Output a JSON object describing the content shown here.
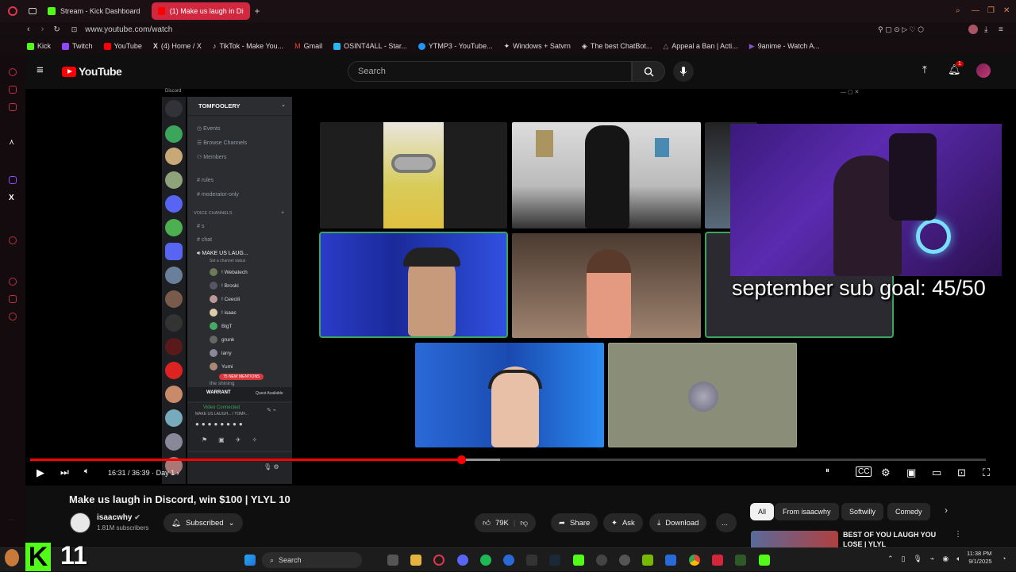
{
  "browser": {
    "tabs": [
      {
        "label": "Stream - Kick Dashboard",
        "color": "#53fc18"
      },
      {
        "label": "(1) Make us laugh in Disc",
        "color": "#ff0000"
      }
    ],
    "new_tab": "+",
    "url": "www.youtube.com/watch",
    "bookmarks": [
      {
        "label": "Kick",
        "color": "#53fc18"
      },
      {
        "label": "Twitch",
        "color": "#9146ff"
      },
      {
        "label": "YouTube",
        "color": "#ff0000"
      },
      {
        "label": "(4) Home / X",
        "color": "#ffffff"
      },
      {
        "label": "TikTok - Make You...",
        "color": "#ffffff"
      },
      {
        "label": "Gmail",
        "color": "#ea4335"
      },
      {
        "label": "OSINT4ALL - Star...",
        "color": "#29b6f6"
      },
      {
        "label": "YTMP3 - YouTube...",
        "color": "#2196f3"
      },
      {
        "label": "Windows + Satvrn",
        "color": "#ffffff"
      },
      {
        "label": "The best ChatBot...",
        "color": "#ffffff"
      },
      {
        "label": "Appeal a Ban | Acti...",
        "color": "#888888"
      },
      {
        "label": "9anime - Watch A...",
        "color": "#7e57c2"
      }
    ]
  },
  "youtube": {
    "logo": "YouTube",
    "search_placeholder": "Search",
    "notifications_count": "1"
  },
  "discord": {
    "app_name": "Discord",
    "server_name": "TOMFOOLERY",
    "channels": [
      "Events",
      "Browse Channels",
      "Members",
      "rules",
      "moderator-only"
    ],
    "voice_header": "VOICE CHANNELS",
    "voice_channels": [
      "s",
      "chat"
    ],
    "active_voice": "MAKE US LAUG...",
    "active_voice_sub": "Set a channel status",
    "members": [
      "! Webatech",
      "! Broski",
      "! Ceecili",
      "! isaac",
      "BigT",
      "grunk",
      "larry",
      "Yumi",
      "the shining"
    ],
    "new_mentions": "75 NEW MENTIONS",
    "quest_game": "WARRANT",
    "quest_label": "Quest Available",
    "video_connected": "Video Connected",
    "video_connected_sub": "MAKE US LAUGH... / TOMF..."
  },
  "stream_overlay": {
    "sub_goal": "september sub goal: 45/50",
    "kick_logo": "K",
    "kick_count": "11"
  },
  "player": {
    "current_time": "16:31",
    "duration": "36:39",
    "chapter": "Day 1",
    "progress": 0.4512,
    "buffered": 0.4916
  },
  "video": {
    "title": "Make us laugh in Discord, win $100 | YLYL 10",
    "channel": "isaacwhy",
    "subscribers": "1.81M subscribers",
    "subscribed_label": "Subscribed",
    "likes": "79K",
    "share_label": "Share",
    "ask_label": "Ask",
    "download_label": "Download",
    "more_label": "..."
  },
  "chips": [
    "All",
    "From isaacwhy",
    "Softwilly",
    "Comedy"
  ],
  "related": {
    "title_line1": "BEST OF YOU LAUGH YOU",
    "title_line2": "LOSE | YLYL"
  },
  "taskbar": {
    "search_label": "Search",
    "time": "11:38 PM",
    "date": "9/1/2025"
  }
}
